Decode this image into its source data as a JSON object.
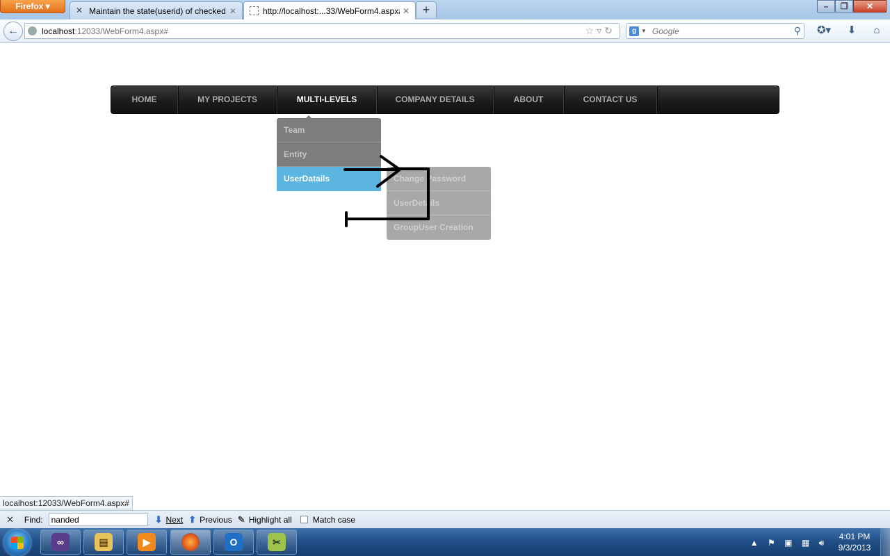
{
  "browser": {
    "app_button": "Firefox",
    "tabs": [
      {
        "title": "Maintain the state(userid) of checked...",
        "active": false
      },
      {
        "title": "http://localhost:...33/WebForm4.aspx#",
        "active": true
      }
    ],
    "new_tab": "+",
    "url": {
      "host": "localhost",
      "path": ":12033/WebForm4.aspx#"
    },
    "search_placeholder": "Google"
  },
  "page": {
    "menu": [
      {
        "label": "HOME"
      },
      {
        "label": "MY PROJECTS"
      },
      {
        "label": "MULTI-LEVELS"
      },
      {
        "label": "COMPANY DETAILS"
      },
      {
        "label": "ABOUT"
      },
      {
        "label": "CONTACT US"
      }
    ],
    "submenu": [
      {
        "label": "Team"
      },
      {
        "label": "Entity"
      },
      {
        "label": "UserDatails"
      }
    ],
    "subsubmenu": [
      {
        "label": "Change Password"
      },
      {
        "label": "UserDetails"
      },
      {
        "label": "GroupUser Creation"
      }
    ]
  },
  "status_url": "localhost:12033/WebForm4.aspx#",
  "findbar": {
    "label": "Find:",
    "value": "nanded",
    "next": "Next",
    "previous": "Previous",
    "highlight_all": "Highlight all",
    "match_case": "Match case"
  },
  "taskbar": {
    "time": "4:01 PM",
    "date": "9/3/2013"
  },
  "colors": {
    "menu_bg": "#1c1c1c",
    "submenu_bg": "#7d7d7d",
    "submenu_highlight": "#5bb5de",
    "subsubmenu_bg": "#a8a8a8"
  }
}
